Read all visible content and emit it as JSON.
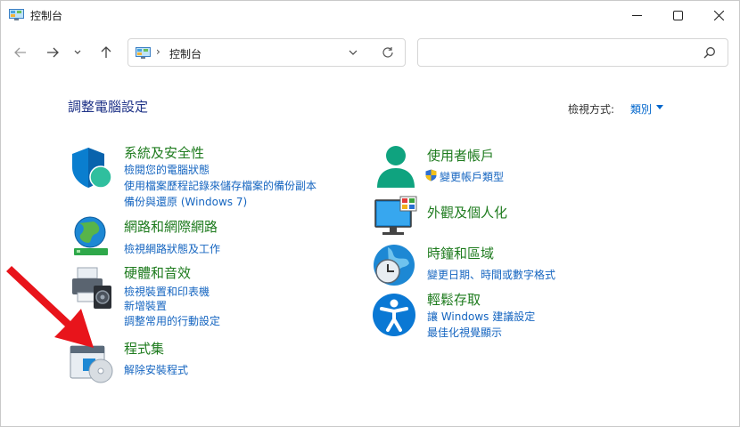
{
  "window": {
    "title": "控制台",
    "controls": {
      "minimize_icon": "minimize-icon",
      "maximize_icon": "maximize-icon",
      "close_icon": "close-icon"
    }
  },
  "navbar": {
    "address_sep": "›",
    "address_text": "控制台",
    "search_placeholder": ""
  },
  "main": {
    "heading": "調整電腦設定",
    "view_by_label": "檢視方式:",
    "view_by_value": "類別"
  },
  "categories": [
    {
      "title": "系統及安全性",
      "icon": "shield-icon",
      "links": [
        "檢閱您的電腦狀態",
        "使用檔案歷程記錄來儲存檔案的備份副本",
        "備份與還原 (Windows 7)"
      ]
    },
    {
      "title": "網路和網際網路",
      "icon": "network-globe-icon",
      "links": [
        "檢視網路狀態及工作"
      ]
    },
    {
      "title": "硬體和音效",
      "icon": "printer-speaker-icon",
      "links": [
        "檢視裝置和印表機",
        "新增裝置",
        "調整常用的行動設定"
      ]
    },
    {
      "title": "程式集",
      "icon": "programs-disc-icon",
      "links": [
        "解除安裝程式"
      ]
    },
    {
      "title": "使用者帳戶",
      "icon": "user-icon",
      "links": [
        "變更帳戶類型"
      ]
    },
    {
      "title": "外觀及個人化",
      "icon": "monitor-personalize-icon",
      "links": []
    },
    {
      "title": "時鐘和區域",
      "icon": "clock-globe-icon",
      "links": [
        "變更日期、時間或數字格式"
      ]
    },
    {
      "title": "輕鬆存取",
      "icon": "accessibility-icon",
      "links": [
        "讓 Windows 建議設定",
        "最佳化視覺顯示"
      ]
    }
  ],
  "colors": {
    "category_title": "#1e7b1e",
    "link": "#1565c0",
    "heading": "#1e3287",
    "arrow": "#e8141b"
  }
}
